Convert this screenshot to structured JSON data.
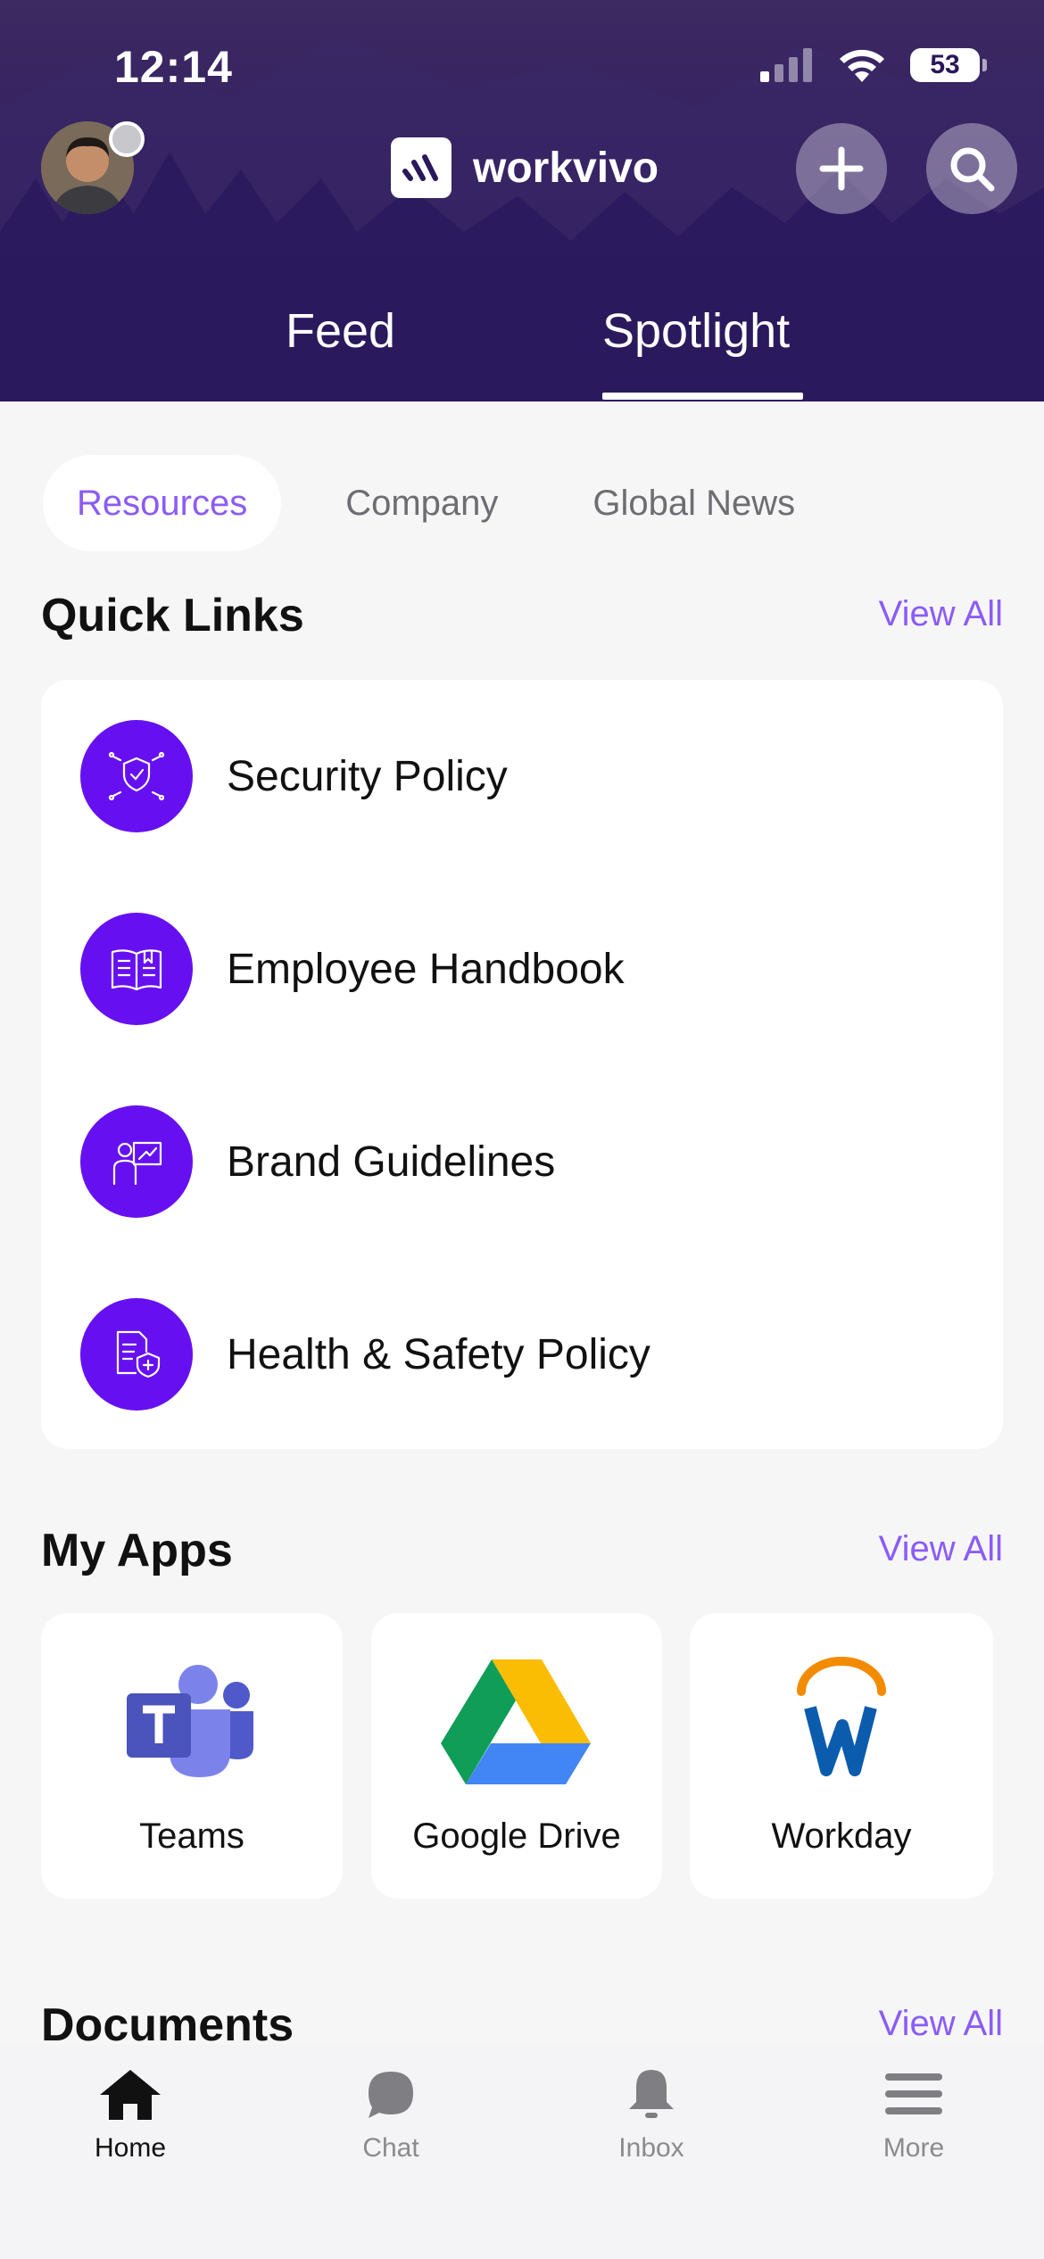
{
  "status_bar": {
    "time": "12:14",
    "battery": "53"
  },
  "header": {
    "brand": "workvivo",
    "tabs": [
      {
        "label": "Feed"
      },
      {
        "label": "Spotlight"
      }
    ],
    "active_tab": "Spotlight"
  },
  "filters": [
    {
      "label": "Resources"
    },
    {
      "label": "Company"
    },
    {
      "label": "Global News"
    }
  ],
  "active_filter": "Resources",
  "quick_links": {
    "title": "Quick Links",
    "view_all": "View All",
    "items": [
      {
        "label": "Security Policy",
        "icon": "security-shield-icon"
      },
      {
        "label": "Employee Handbook",
        "icon": "book-icon"
      },
      {
        "label": "Brand Guidelines",
        "icon": "presentation-icon"
      },
      {
        "label": "Health & Safety Policy",
        "icon": "document-shield-icon"
      }
    ]
  },
  "my_apps": {
    "title": "My Apps",
    "view_all": "View All",
    "items": [
      {
        "label": "Teams",
        "icon": "teams-icon"
      },
      {
        "label": "Google Drive",
        "icon": "google-drive-icon"
      },
      {
        "label": "Workday",
        "icon": "workday-icon"
      }
    ]
  },
  "documents": {
    "title": "Documents",
    "view_all": "View All"
  },
  "tabbar": {
    "items": [
      {
        "label": "Home",
        "icon": "home-icon"
      },
      {
        "label": "Chat",
        "icon": "chat-icon"
      },
      {
        "label": "Inbox",
        "icon": "bell-icon"
      },
      {
        "label": "More",
        "icon": "menu-icon"
      }
    ],
    "active": "Home"
  },
  "colors": {
    "accent": "#8b5cf6",
    "quick_link_icon_bg": "#6610f2",
    "header_bg": "#2b175b"
  }
}
